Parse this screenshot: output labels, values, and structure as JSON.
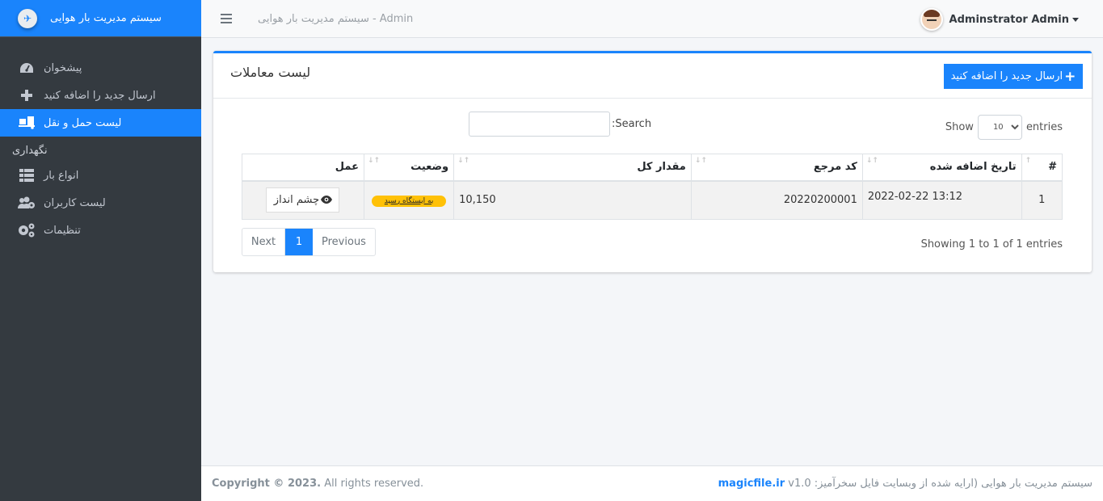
{
  "brand": {
    "title": "سیستم مدیریت بار هوایی"
  },
  "sidebar": {
    "items": [
      {
        "label": "پیشخوان",
        "icon": "dashboard-gauge-icon",
        "active": false
      },
      {
        "label": "ارسال جدید را اضافه کنید",
        "icon": "plus-icon",
        "active": false
      },
      {
        "label": "لیست حمل و نقل",
        "icon": "dolly-flatbed-icon",
        "active": true
      }
    ],
    "section_header": "نگهداری",
    "maintenance_items": [
      {
        "label": "انواع بار",
        "icon": "th-list-icon"
      },
      {
        "label": "لیست کاربران",
        "icon": "users-cog-icon"
      },
      {
        "label": "تنظیمات",
        "icon": "cogs-icon"
      }
    ]
  },
  "topbar": {
    "title": "سیستم مدیریت بار هوایی - Admin",
    "user_name": "Adminstrator Admin"
  },
  "card": {
    "title": "لیست معاملات",
    "add_button": "ارسال جدید را اضافه کنید",
    "length": {
      "show": "Show",
      "value": "10",
      "entries": "entries"
    },
    "search": {
      "label": "Search:",
      "value": ""
    },
    "table": {
      "headers": [
        "#",
        "تاریخ اضافه شده",
        "کد مرجع",
        "مقدار کل",
        "وضعیت",
        "عمل"
      ],
      "rows": [
        {
          "index": "1",
          "date": "2022-02-22 13:12",
          "ref": "20220200001",
          "amount": "10,150",
          "status": "به ایستگاه رسید",
          "action": "چشم انداز"
        }
      ]
    },
    "pagination": {
      "next": "Next",
      "current": "1",
      "previous": "Previous"
    },
    "info": "Showing 1 to 1 of 1 entries"
  },
  "footer": {
    "copyright_bold": "Copyright © 2023.",
    "copyright_rest": " All rights reserved.",
    "credit_text": "سیستم مدیریت بار هوایی (ارایه شده از وبسایت فایل سخرآمیز:",
    "credit_link": "magicfile.ir",
    "version": "v1.0"
  },
  "colors": {
    "primary": "#1a84fc",
    "sidebar": "#343a40",
    "badge": "#ffc107"
  }
}
